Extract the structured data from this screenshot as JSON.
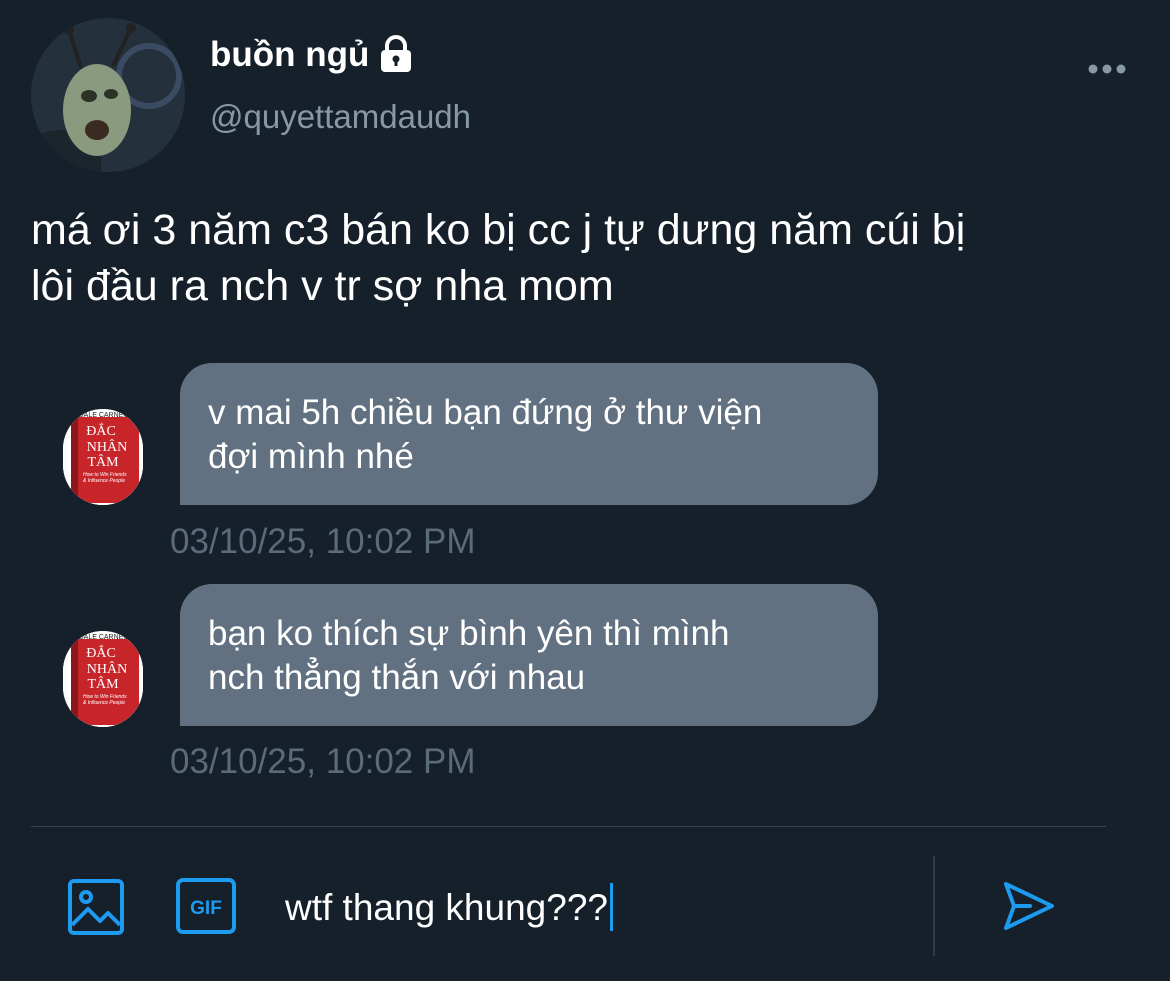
{
  "profile": {
    "display_name": "buồn ngủ",
    "handle": "@quyettamdaudh",
    "lock_icon": "lock-icon",
    "more_icon": "more-horizontal-icon"
  },
  "tweet": {
    "text_line1": "má ơi 3 năm c3 bán ko bị cc j tự dưng năm cúi bị",
    "text_line2": "lôi đầu ra nch v tr sợ nha mom"
  },
  "messages": [
    {
      "line1": "v mai 5h chiều bạn đứng ở thư viện",
      "line2": "đợi mình nhé",
      "timestamp": "03/10/25, 10:02 PM"
    },
    {
      "line1": "bạn ko thích sự bình yên thì mình",
      "line2": "nch thẳng thắn với nhau",
      "timestamp": "03/10/25, 10:02 PM"
    }
  ],
  "book_cover": {
    "author": "DALE CARNEGIE",
    "title_line1": "ĐẮC",
    "title_line2": "NHÂN",
    "title_line3": "TÂM",
    "subtitle_line1": "How to Win Friends",
    "subtitle_line2": "& Influence People"
  },
  "composer": {
    "value": "wtf thang khung???",
    "gif_label": "GIF",
    "media_icon": "image-icon",
    "send_icon": "send-icon"
  },
  "colors": {
    "background": "#15202b",
    "bubble": "#627181",
    "accent": "#1d9bf0",
    "muted": "#8899a6"
  }
}
